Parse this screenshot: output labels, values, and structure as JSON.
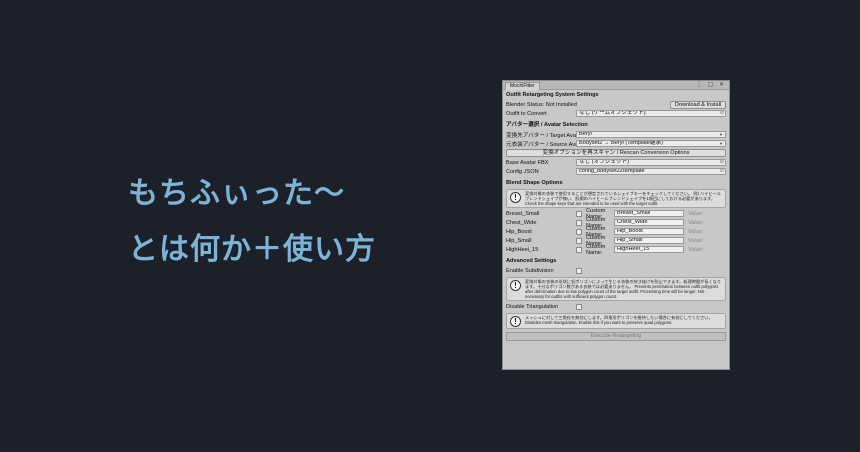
{
  "hero": {
    "line1": "もちふぃった〜",
    "line2": "とは何か＋使い方"
  },
  "window": {
    "tab_title": "MochiFitter",
    "controls": "⋮ ▢ ✕",
    "system_settings": {
      "header": "Outfit Retargeting System Settings",
      "blender_status": "Blender Status: Not Installed",
      "install_button": "Download & Install",
      "outfit_label": "Outfit to Convert",
      "outfit_value": "なし (ゲームオブジェクト)"
    },
    "avatar_selection": {
      "header": "アバター選択 / Avatar Selection",
      "target_label": "変換先アバター / Target Avatar",
      "target_value": "Beryl",
      "source_label": "元衣装アバター / Source Avatar",
      "source_value": "Bodyset2 → Beryl (Template継承)",
      "rescan_button": "変換オプションを再スキャン / Rescan Conversion Options",
      "fbx_label": "Base Avatar FBX",
      "fbx_value": "なし (オブジェクト)",
      "config_label": "Config JSON",
      "config_value": "config_bodyset2Ztemplate"
    },
    "blend_shapes": {
      "header": "Blend Shape Options",
      "help": "変換対象の衣装で使用することが想定されているシェイプキーをチェックしてください。 例) ハイヒールブレンドシェイプが無い、肌側のハイヒールブレンドシェイプを1項目にしておける必要があります。 Check the shape keys that are intended to be used with the target outfit.",
      "custom_label": "Custom Name:",
      "value_label": "Value:",
      "rows": [
        {
          "name": "Breast_Small",
          "custom": "Breast_Small"
        },
        {
          "name": "Chest_Wide",
          "custom": "Chest_Wide"
        },
        {
          "name": "Hip_Boost",
          "custom": "Hip_Boost"
        },
        {
          "name": "Hip_Small",
          "custom": "Hip_Small"
        },
        {
          "name": "HighHeel_15",
          "custom": "HighHeel_15"
        }
      ]
    },
    "advanced": {
      "header": "Advanced Settings",
      "subdivision_label": "Enable Subdivision",
      "subdivision_help": "変換対象の衣装の形状に低ポリゴンによって生じる衣装の突き抜けを防止できます。処理時間が長くなります。十分なポリゴン数がある衣装では必要ありません。 Prevents penetration between outfit polygons after deformation due to low polygon count of the target outfit. Processing time will be longer. Not necessary for outfits with sufficient polygon count.",
      "triangulation_label": "Disable Triangulation",
      "triangulation_help": "メッシュに対して三角化を無効にします。四角形ポリゴンを維持したい場合に有効にしてください。 Disables mesh triangulation. Enable this if you want to preserve quad polygons.",
      "execute_button": "Execute Retargeting"
    }
  }
}
